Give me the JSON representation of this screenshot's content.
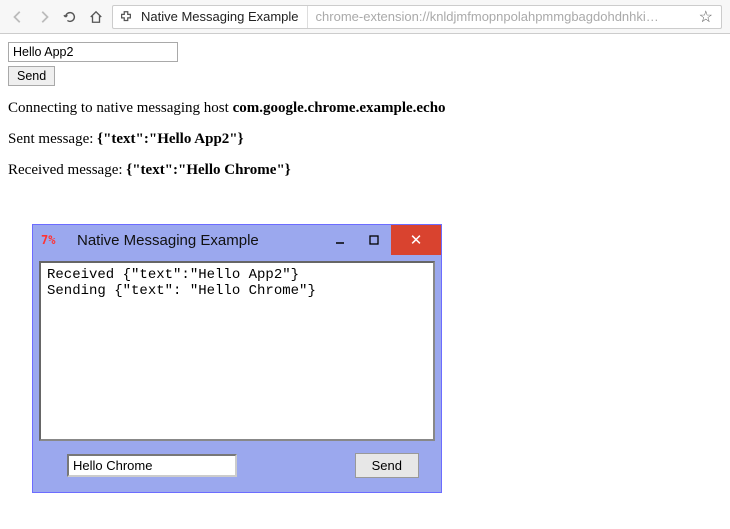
{
  "browser": {
    "page_title": "Native Messaging Example",
    "url": "chrome-extension://knldjmfmopnpolahpmmgbagdohdnhki…"
  },
  "web": {
    "input_value": "Hello App2",
    "send_label": "Send",
    "connect_prefix": "Connecting to native messaging host ",
    "connect_host": "com.google.chrome.example.echo",
    "sent_prefix": "Sent message: ",
    "sent_payload": "{\"text\":\"Hello App2\"}",
    "recv_prefix": "Received message: ",
    "recv_payload": "{\"text\":\"Hello Chrome\"}"
  },
  "native": {
    "tk_icon": "7%",
    "title": "Native Messaging Example",
    "log_line1": "Received {\"text\":\"Hello App2\"}",
    "log_line2": "Sending {\"text\": \"Hello Chrome\"}",
    "input_value": "Hello Chrome",
    "send_label": "Send",
    "close_glyph": "✕"
  }
}
